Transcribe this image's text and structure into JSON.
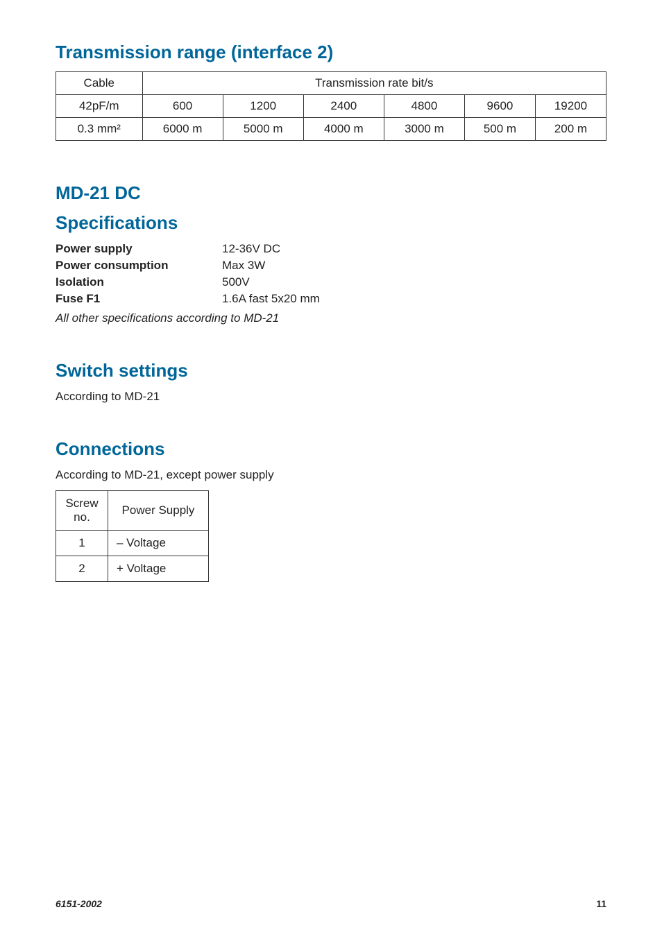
{
  "section1": {
    "title": "Transmission range (interface 2)",
    "table": {
      "header_cable": "Cable",
      "header_trans": "Transmission rate bit/s",
      "row1": {
        "c0": "42pF/m",
        "c1": "600",
        "c2": "1200",
        "c3": "2400",
        "c4": "4800",
        "c5": "9600",
        "c6": "19200"
      },
      "row2": {
        "c0": "0.3 mm²",
        "c1": "6000 m",
        "c2": "5000 m",
        "c3": "4000 m",
        "c4": "3000 m",
        "c5": "500 m",
        "c6": "200 m"
      }
    }
  },
  "section2": {
    "title": "MD-21 DC",
    "subtitle": "Specifications",
    "specs": [
      {
        "label": "Power supply",
        "value": "12-36V DC"
      },
      {
        "label": "Power consumption",
        "value": "Max 3W"
      },
      {
        "label": "Isolation",
        "value": "500V"
      },
      {
        "label": "Fuse F1",
        "value": "1.6A fast 5x20 mm"
      }
    ],
    "note": "All other specifications according to MD-21"
  },
  "section3": {
    "title": "Switch settings",
    "body": "According to MD-21"
  },
  "section4": {
    "title": "Connections",
    "body": "According to MD-21, except power supply",
    "table": {
      "h1": "Screw no.",
      "h2": "Power Supply",
      "rows": [
        {
          "c0": "1",
          "c1": "– Voltage"
        },
        {
          "c0": "2",
          "c1": "+ Voltage"
        }
      ]
    }
  },
  "footer": {
    "left": "6151-2002",
    "right": "11"
  }
}
